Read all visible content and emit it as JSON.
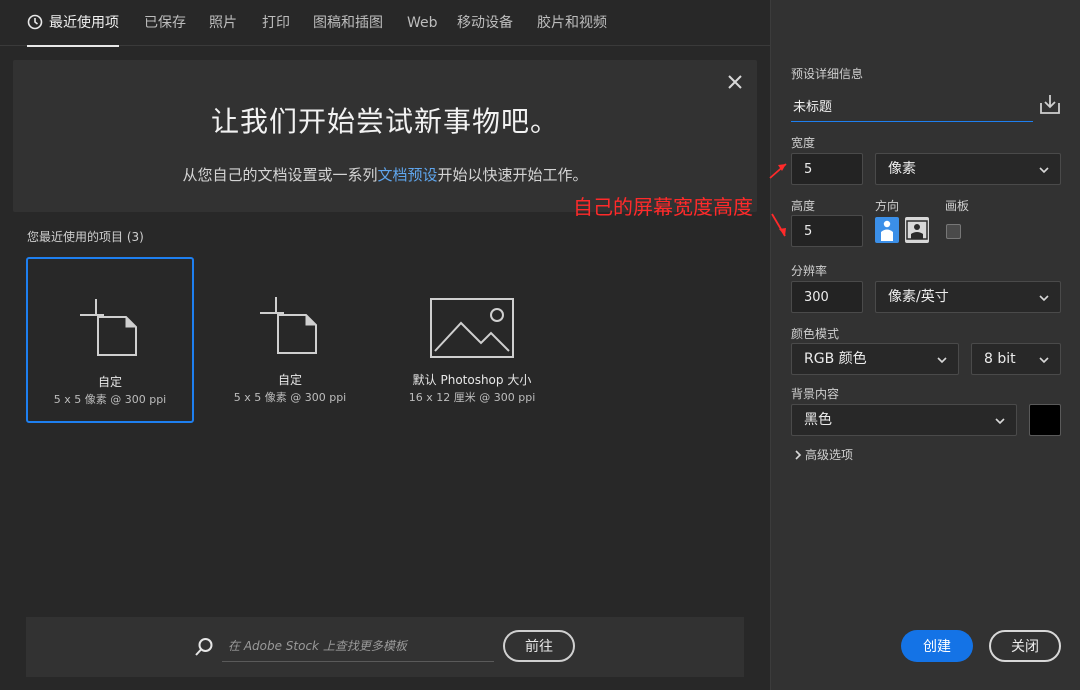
{
  "tabs": [
    {
      "label": "最近使用项",
      "active": true
    },
    {
      "label": "已保存"
    },
    {
      "label": "照片"
    },
    {
      "label": "打印"
    },
    {
      "label": "图稿和插图"
    },
    {
      "label": "Web"
    },
    {
      "label": "移动设备"
    },
    {
      "label": "胶片和视频"
    }
  ],
  "hero": {
    "title": "让我们开始尝试新事物吧。",
    "subtitle_pre": "从您自己的文档设置或一系列",
    "subtitle_link": "文档预设",
    "subtitle_post": "开始以快速开始工作。"
  },
  "recent": {
    "title": "您最近使用的项目 (3)",
    "items": [
      {
        "name": "自定",
        "size": "5 x 5 像素 @ 300 ppi",
        "icon": "custom-doc-icon"
      },
      {
        "name": "自定",
        "size": "5 x 5 像素 @ 300 ppi",
        "icon": "custom-doc-icon"
      },
      {
        "name": "默认 Photoshop 大小",
        "size": "16 x 12 厘米 @ 300 ppi",
        "icon": "image-icon"
      }
    ]
  },
  "stock": {
    "placeholder": "在 Adobe Stock 上查找更多模板",
    "go_label": "前往"
  },
  "preset": {
    "section_label": "预设详细信息",
    "doc_name": "未标题",
    "width_label": "宽度",
    "width_value": "5",
    "width_unit": "像素",
    "height_label": "高度",
    "height_value": "5",
    "orientation_label": "方向",
    "artboard_label": "画板",
    "resolution_label": "分辨率",
    "resolution_value": "300",
    "resolution_unit": "像素/英寸",
    "color_mode_label": "颜色模式",
    "color_mode_value": "RGB 颜色",
    "bit_depth_value": "8 bit",
    "background_label": "背景内容",
    "background_value": "黑色",
    "background_color": "#000000",
    "advanced_label": "高级选项",
    "create_label": "创建",
    "close_label": "关闭"
  },
  "annotation": {
    "text": "自己的屏幕宽度高度",
    "color": "#ff2a2a"
  },
  "colors": {
    "accent": "#1473e6",
    "link": "#5fa5ec",
    "selected_border": "#1e7ff0"
  }
}
